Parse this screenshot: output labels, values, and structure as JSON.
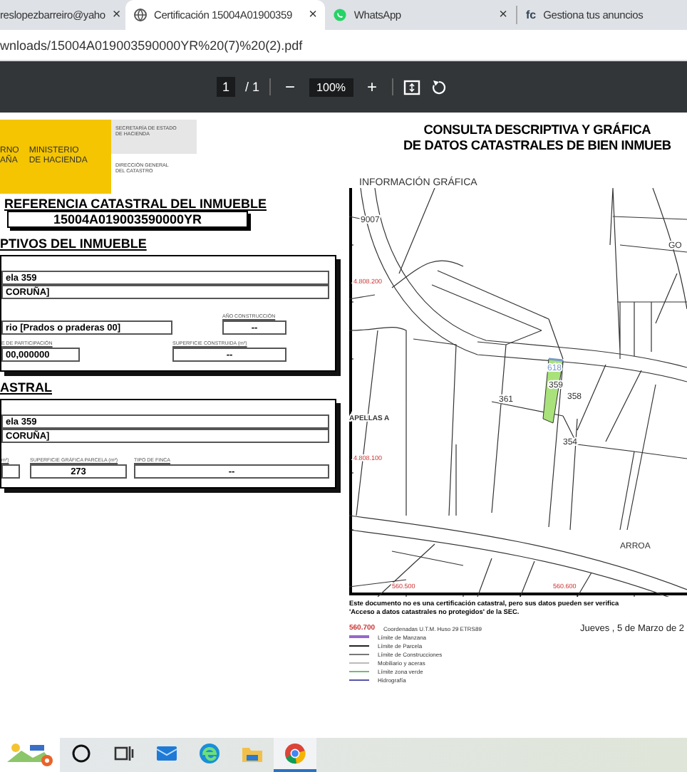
{
  "browser": {
    "tabs": [
      {
        "title": "reslopezbarreiro@yaho",
        "kind": "none",
        "close": "×",
        "selected": false
      },
      {
        "title": "Certificación 15004A01900359",
        "kind": "globe",
        "close": "×",
        "selected": true
      },
      {
        "title": "WhatsApp",
        "kind": "chat",
        "close": "×",
        "selected": false
      },
      {
        "title": "Gestiona tus anuncios",
        "kind": "text",
        "favicon": "fc",
        "selected": false
      }
    ],
    "address": "wnloads/15004A019003590000YR%20(7)%20(2).pdf"
  },
  "pdf_toolbar": {
    "page": "1",
    "total": "/ 1",
    "zoom_out": "−",
    "zoom": "100%",
    "zoom_in": "+"
  },
  "document": {
    "emblem": "RNO\nAÑA",
    "ministry": "MINISTERIO\nDE HACIENDA",
    "secretariat": "SECRETARÍA DE ESTADO\nDE HACIENDA",
    "directorate": "DIRECCIÓN GENERAL\nDEL CATASTRO",
    "reference": {
      "title": "REFERENCIA CATASTRAL DEL INMUEBLE",
      "value": "15004A019003590000YR"
    },
    "sections": [
      {
        "title": "PTIVOS DEL INMUEBLE",
        "rows": [
          [
            {
              "value": "ela 359"
            }
          ],
          [
            {
              "value": "CORUÑA]"
            }
          ],
          [
            {
              "value": "rio [Prados o praderas 00]"
            },
            {
              "label": "AÑO CONSTRUCCIÓN",
              "value": "--"
            }
          ],
          [
            {
              "label": "E DE PARTICIPACIÓN",
              "value": "00,000000"
            },
            {
              "label": "SUPERFICIE CONSTRUIDA (m²)",
              "value": "--"
            }
          ]
        ]
      },
      {
        "title": "ASTRAL",
        "rows": [
          [
            {
              "value": "ela 359"
            }
          ],
          [
            {
              "value": "CORUÑA]"
            }
          ],
          [
            {
              "label": "m²)"
            },
            {
              "label": "SUPERFICIE GRÁFICA PARCELA (m²)",
              "value": "273"
            },
            {
              "label": "TIPO DE FINCA",
              "value": "--"
            }
          ]
        ]
      }
    ],
    "title": "CONSULTA DESCRIPTIVA Y GRÁFICA\nDE DATOS CATASTRALES DE BIEN INMUEB",
    "map": {
      "title": "INFORMACIÓN GRÁFICA",
      "labels": [
        {
          "text": "9007",
          "kind": "place"
        },
        {
          "text": "GO",
          "kind": "place"
        },
        {
          "text": "4.808.200",
          "kind": "coordinate"
        },
        {
          "text": "618",
          "kind": "highlight"
        },
        {
          "text": "359",
          "kind": "parcel"
        },
        {
          "text": "358",
          "kind": "parcel"
        },
        {
          "text": "361",
          "kind": "parcel"
        },
        {
          "text": "APELLAS A",
          "kind": "bold"
        },
        {
          "text": "354",
          "kind": "parcel"
        },
        {
          "text": "4.808.100",
          "kind": "coordinate"
        },
        {
          "text": "ARROA",
          "kind": "place"
        },
        {
          "text": "560.500",
          "kind": "coordinate"
        },
        {
          "text": "560.600",
          "kind": "coordinate"
        }
      ]
    },
    "note": "Este documento no es una certificación catastral, pero sus datos pueden ser verifica\n'Acceso a datos catastrales no protegidos' de la SEC.",
    "date": "Jueves , 5 de Marzo de 2",
    "legend": [
      {
        "kind": "coordinate",
        "sample": "560.700",
        "text": "Coordenadas U.T.M. Huso 29 ETRS89",
        "color": "#cc3333"
      },
      {
        "kind": "line",
        "text": "Límite de Manzana",
        "color": "#9966cc"
      },
      {
        "kind": "line",
        "text": "Límite de Parcela",
        "color": "#222222"
      },
      {
        "kind": "line",
        "text": "Límite de Construcciones",
        "color": "#777777"
      },
      {
        "kind": "line",
        "text": "Mobiliario y aceras",
        "color": "#bbbbbb"
      },
      {
        "kind": "line",
        "text": "Límite zona verde",
        "color": "#77bb77"
      },
      {
        "kind": "line",
        "text": "Hidrografía",
        "color": "#5555aa"
      }
    ]
  },
  "taskbar": {
    "apps": [
      {
        "kind": "weather",
        "selected": false
      },
      {
        "kind": "search",
        "selected": false
      },
      {
        "kind": "taskview",
        "selected": false
      },
      {
        "kind": "mail",
        "selected": false
      },
      {
        "kind": "edge",
        "selected": false
      },
      {
        "kind": "files",
        "selected": false
      },
      {
        "kind": "chrome",
        "selected": true
      }
    ]
  }
}
